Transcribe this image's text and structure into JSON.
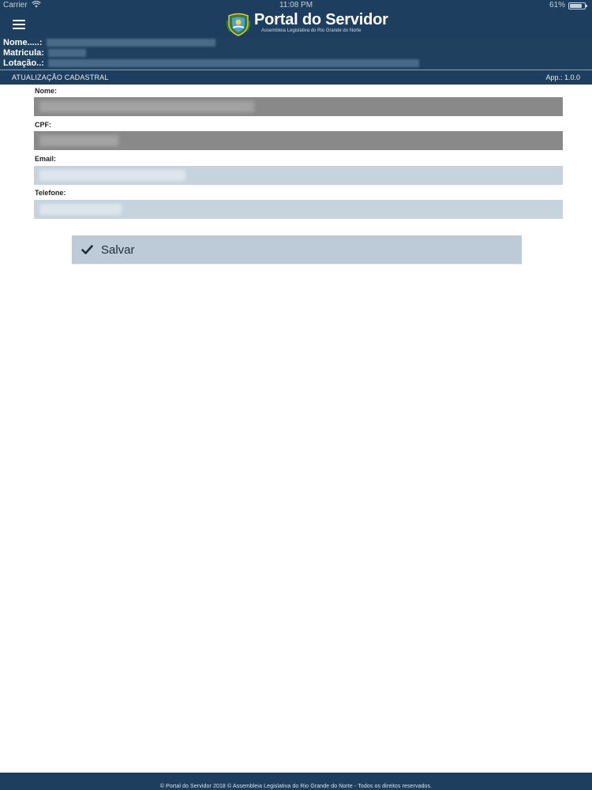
{
  "status_bar": {
    "carrier": "Carrier",
    "time": "11:08 PM",
    "battery": "61%"
  },
  "header": {
    "brand": "Portal do Servidor",
    "subtitle": "Assembleia Legislativa do Rio Grande do Norte",
    "menu_icon": "hamburger-menu-icon",
    "logo_icon": "crest-icon"
  },
  "user_info": {
    "name_label": "Nome.....:",
    "matricula_label": "Matricula:",
    "lotacao_label": "Lotação..:"
  },
  "section": {
    "title": "ATUALIZAÇÃO CADASTRAL",
    "version": "App.: 1.0.0"
  },
  "form": {
    "fields": [
      {
        "label": "Nome:"
      },
      {
        "label": "CPF:"
      },
      {
        "label": "Email:"
      },
      {
        "label": "Telefone:"
      }
    ],
    "save_label": "Salvar",
    "save_icon": "check-icon"
  },
  "footer": {
    "text": "© Portal do Servidor 2018 © Assembleia Legislativa do Rio Grande do Norte - Todos os direitos reservados."
  },
  "colors": {
    "header_bg": "#1d3e5e",
    "readonly_field": "#898989",
    "editable_field": "#c6d2dc",
    "button_bg": "#bccbd7"
  }
}
